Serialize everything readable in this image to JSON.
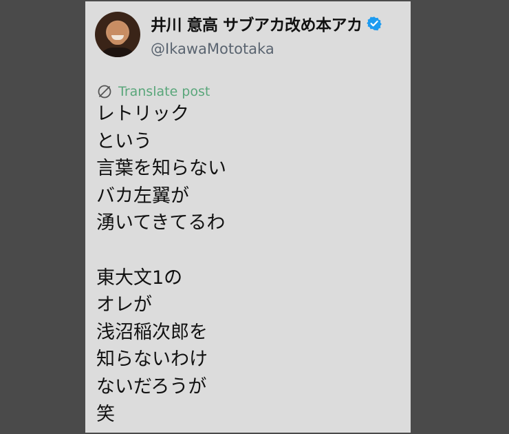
{
  "author": {
    "display_name": "井川 意高 サブアカ改め本アカ",
    "handle": "@IkawaMototaka",
    "verified_icon": "verified-badge-icon",
    "avatar_icon": "profile-photo"
  },
  "translate": {
    "icon": "translate-globe-icon",
    "label": "Translate post",
    "color": "#59a67a"
  },
  "post": {
    "lines": [
      "レトリック",
      "という",
      "言葉を知らない",
      "バカ左翼が",
      "湧いてきてるわ",
      "",
      "東大文1の",
      "オレが",
      "浅沼稲次郎を",
      "知らないわけ",
      "ないだろうが",
      "笑"
    ]
  },
  "colors": {
    "background": "#4a4a4a",
    "card": "#dcdcdc",
    "verified": "#1d9bf0"
  }
}
